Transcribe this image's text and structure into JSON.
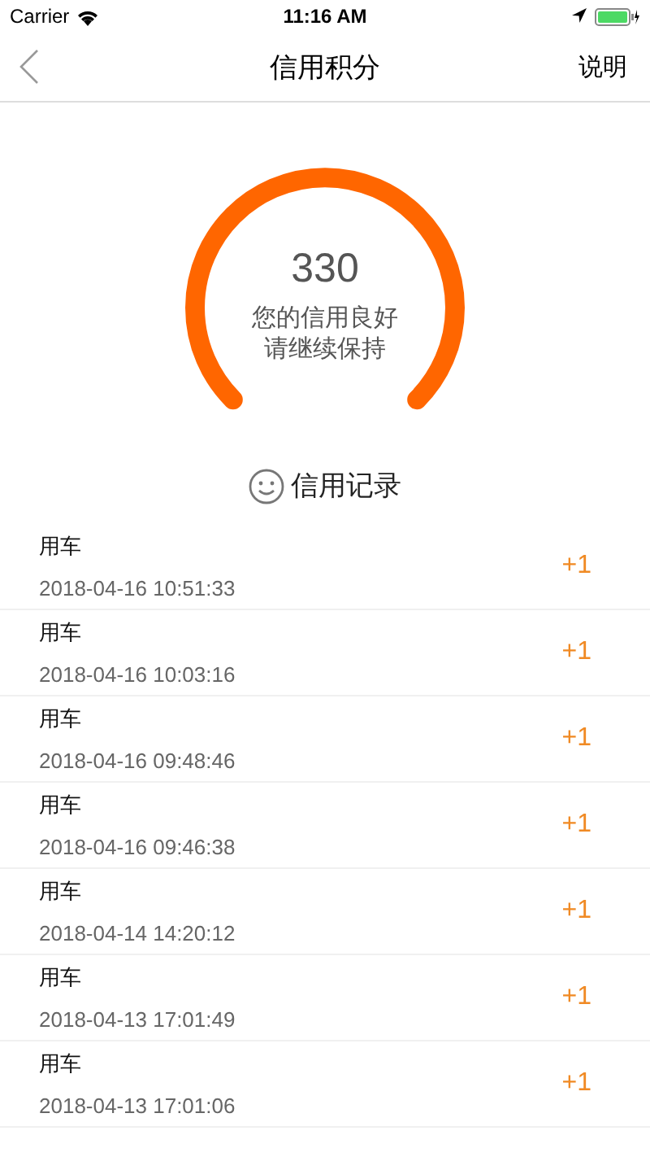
{
  "status_bar": {
    "carrier": "Carrier",
    "time": "11:16 AM"
  },
  "nav": {
    "title": "信用积分",
    "action": "说明"
  },
  "score": {
    "value": "330",
    "lines": [
      "您的信用良好",
      "请继续保持"
    ]
  },
  "records_title": "信用记录",
  "records": [
    {
      "name": "用车",
      "time": "2018-04-16 10:51:33",
      "points": "+1"
    },
    {
      "name": "用车",
      "time": "2018-04-16 10:03:16",
      "points": "+1"
    },
    {
      "name": "用车",
      "time": "2018-04-16 09:48:46",
      "points": "+1"
    },
    {
      "name": "用车",
      "time": "2018-04-16 09:46:38",
      "points": "+1"
    },
    {
      "name": "用车",
      "time": "2018-04-14 14:20:12",
      "points": "+1"
    },
    {
      "name": "用车",
      "time": "2018-04-13 17:01:49",
      "points": "+1"
    },
    {
      "name": "用车",
      "time": "2018-04-13 17:01:06",
      "points": "+1"
    }
  ]
}
